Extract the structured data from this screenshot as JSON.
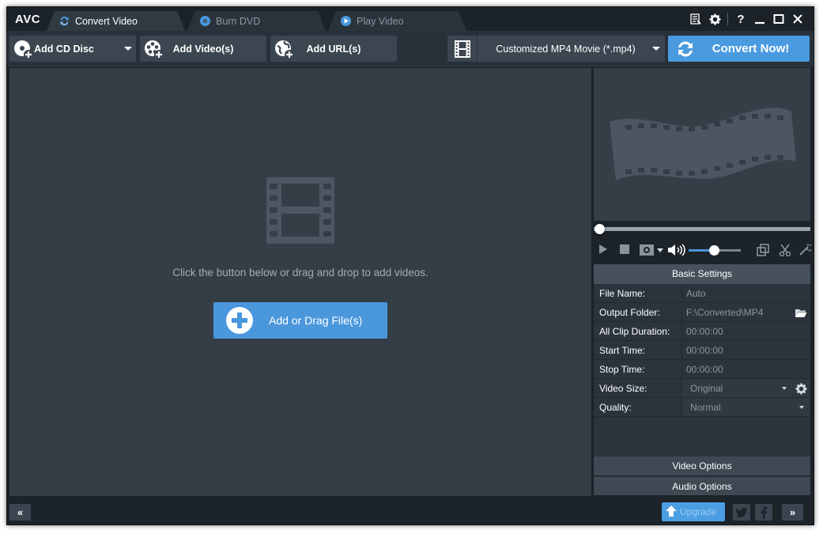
{
  "app": {
    "logo": "AVC"
  },
  "tabs": [
    {
      "label": "Convert Video",
      "active": true
    },
    {
      "label": "Burn DVD",
      "active": false
    },
    {
      "label": "Play Video",
      "active": false
    }
  ],
  "window_controls": {
    "help": "?"
  },
  "toolbar": {
    "add_cd": "Add CD Disc",
    "add_videos": "Add Video(s)",
    "add_url": "Add URL(s)",
    "profile": "Customized MP4 Movie (*.mp4)",
    "convert": "Convert Now!"
  },
  "main": {
    "hint": "Click the button below or drag and drop to add videos.",
    "add_button": "Add or Drag File(s)"
  },
  "player": {
    "seek_position": 0,
    "volume": 0.5
  },
  "settings": {
    "header": "Basic Settings",
    "rows": [
      {
        "key": "File Name:",
        "value": "Auto"
      },
      {
        "key": "Output Folder:",
        "value": "F:\\Converted\\MP4"
      },
      {
        "key": "All Clip Duration:",
        "value": "00:00:00"
      },
      {
        "key": "Start Time:",
        "value": "00:00:00"
      },
      {
        "key": "Stop Time:",
        "value": "00:00:00"
      },
      {
        "key": "Video Size:",
        "value": "Original"
      },
      {
        "key": "Quality:",
        "value": "Normal"
      }
    ],
    "video_options": "Video Options",
    "audio_options": "Audio Options"
  },
  "bottom": {
    "collapse_left": "«",
    "expand_right": "»",
    "upgrade": "Upgrade",
    "twitter": "t",
    "facebook": "f"
  },
  "colors": {
    "accent": "#4a97dc",
    "panel": "#343e47",
    "toolbar": "#28313a",
    "titlebar": "#1b2228"
  },
  "icons": [
    "convert-icon",
    "disc-icon",
    "play-circle-icon",
    "list-icon",
    "gear-icon",
    "close-icon",
    "film-icon",
    "plus-icon",
    "folder-icon",
    "upgrade-icon"
  ]
}
